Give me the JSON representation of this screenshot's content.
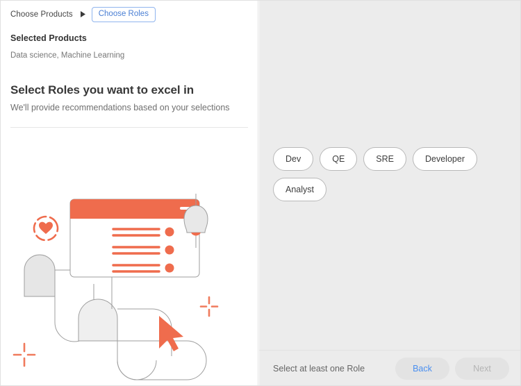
{
  "breadcrumb": {
    "previous_label": "Choose Products",
    "separator_icon": "caret-right-icon",
    "current_label": "Choose Roles"
  },
  "selected_products": {
    "label": "Selected Products",
    "value": "Data science, Machine Learning"
  },
  "heading": {
    "title": "Select Roles you want to excel in",
    "subtitle": "We'll provide recommendations based on your selections"
  },
  "illustration": {
    "name": "onboarding-illustration",
    "icons": [
      "heart-in-dashed-circle-icon",
      "bell-icon",
      "cursor-arrow-icon",
      "crosshair-plus-icon",
      "crosshair-plus-icon"
    ],
    "accent_color": "#ef6c4d",
    "gray_fill": "#e6e6e6",
    "outline_color": "#9e9e9e"
  },
  "roles": {
    "chips": [
      {
        "label": "Dev",
        "selected": false
      },
      {
        "label": "QE",
        "selected": false
      },
      {
        "label": "SRE",
        "selected": false
      },
      {
        "label": "Developer",
        "selected": false
      },
      {
        "label": "Analyst",
        "selected": false
      }
    ]
  },
  "footer": {
    "message": "Select at least one Role",
    "back_label": "Back",
    "next_label": "Next"
  },
  "colors": {
    "accent_orange": "#ef6c4d",
    "link_blue": "#4a8ff0",
    "crumb_blue": "#4a7fd4",
    "panel_gray": "#ececec",
    "chip_border": "#b9b9b9"
  }
}
